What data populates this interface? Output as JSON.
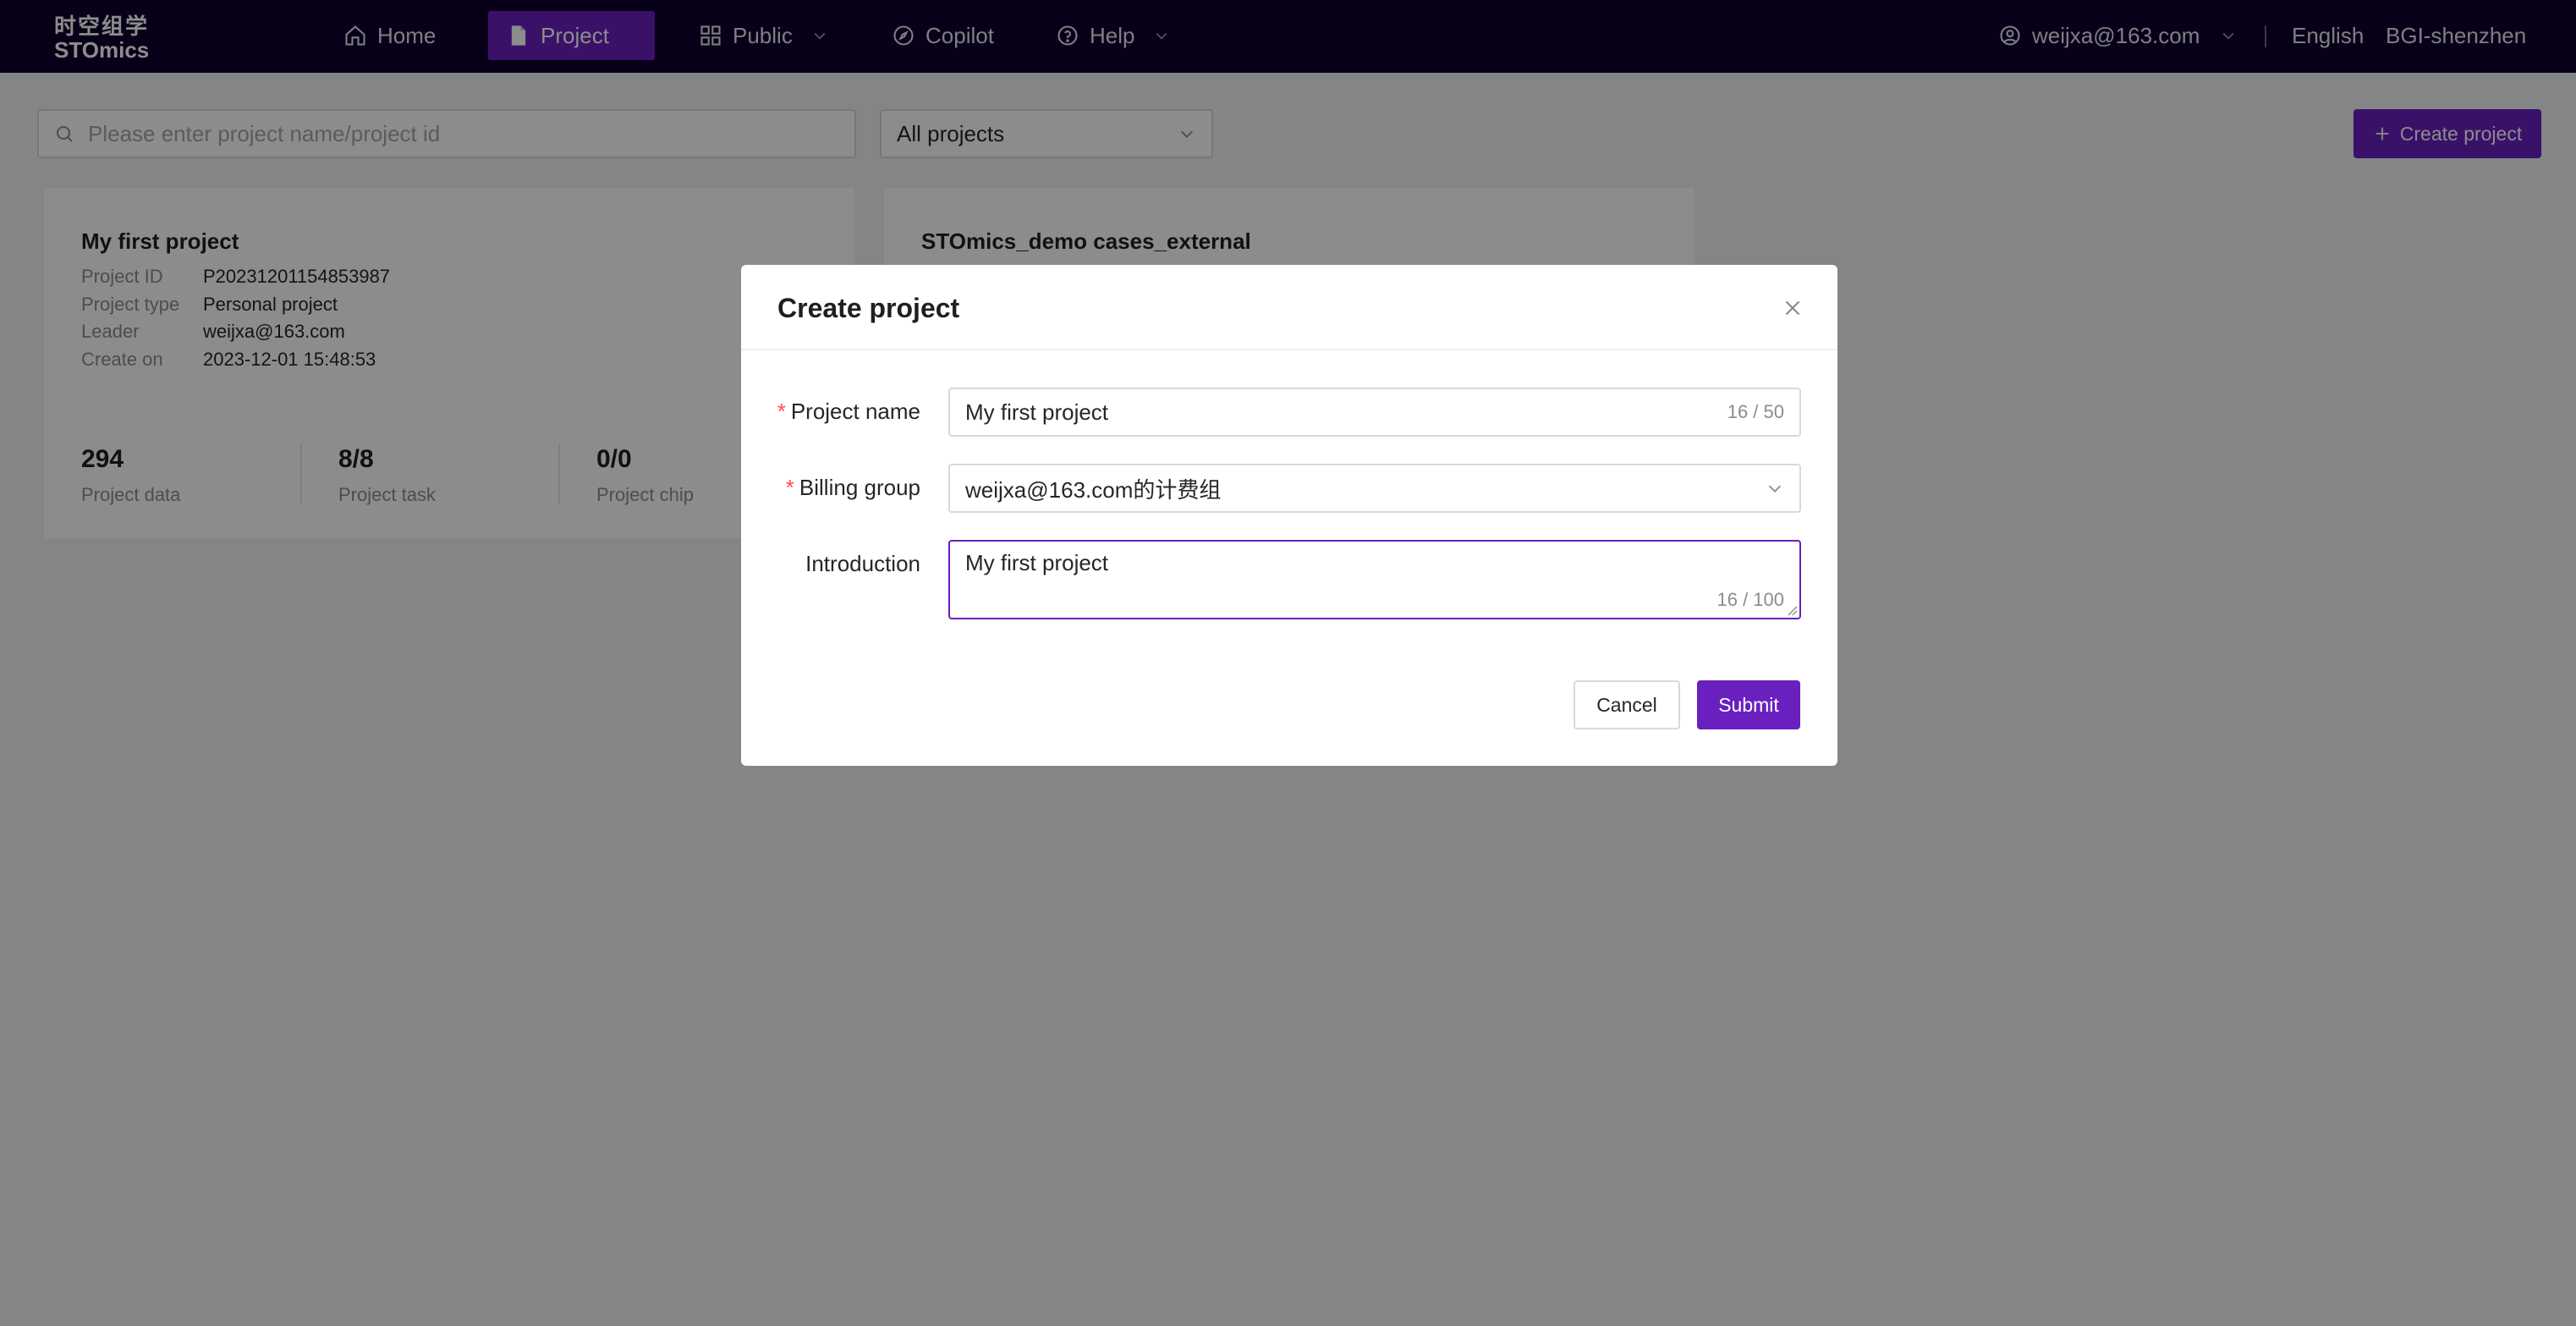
{
  "nav": {
    "logo_cn": "时空组学",
    "logo_en": "STOmics",
    "items": [
      {
        "label": "Home",
        "icon": "home-icon"
      },
      {
        "label": "Project",
        "icon": "file-icon",
        "active": true
      },
      {
        "label": "Public",
        "icon": "grid-icon"
      },
      {
        "label": "Copilot",
        "icon": "compass-icon"
      },
      {
        "label": "Help",
        "icon": "question-icon"
      }
    ],
    "user": "weijxa@163.com",
    "language": "English",
    "region": "BGI-shenzhen"
  },
  "toolbar": {
    "search_placeholder": "Please enter project name/project id",
    "filter_value": "All projects",
    "create_label": "Create project"
  },
  "cards": [
    {
      "title": "My first project",
      "meta": [
        {
          "key": "Project ID",
          "value": "P20231201154853987"
        },
        {
          "key": "Project type",
          "value": "Personal project"
        },
        {
          "key": "Leader",
          "value": "weijxa@163.com"
        },
        {
          "key": "Create on",
          "value": "2023-12-01 15:48:53"
        }
      ],
      "stats": [
        {
          "value": "294",
          "label": "Project data"
        },
        {
          "value": "8/8",
          "label": "Project task"
        },
        {
          "value": "0/0",
          "label": "Project chip"
        }
      ]
    },
    {
      "title": "STOmics_demo cases_external"
    }
  ],
  "modal": {
    "title": "Create project",
    "project_name_label": "Project name",
    "project_name_value": "My first project",
    "project_name_count": "16 / 50",
    "billing_label": "Billing group",
    "billing_value": "weijxa@163.com的计费组",
    "intro_label": "Introduction",
    "intro_value": "My first project",
    "intro_count": "16 / 100",
    "cancel_label": "Cancel",
    "submit_label": "Submit"
  },
  "colors": {
    "nav_bg": "#10002e",
    "accent": "#6a1fbf",
    "required": "#ff4d4f"
  }
}
